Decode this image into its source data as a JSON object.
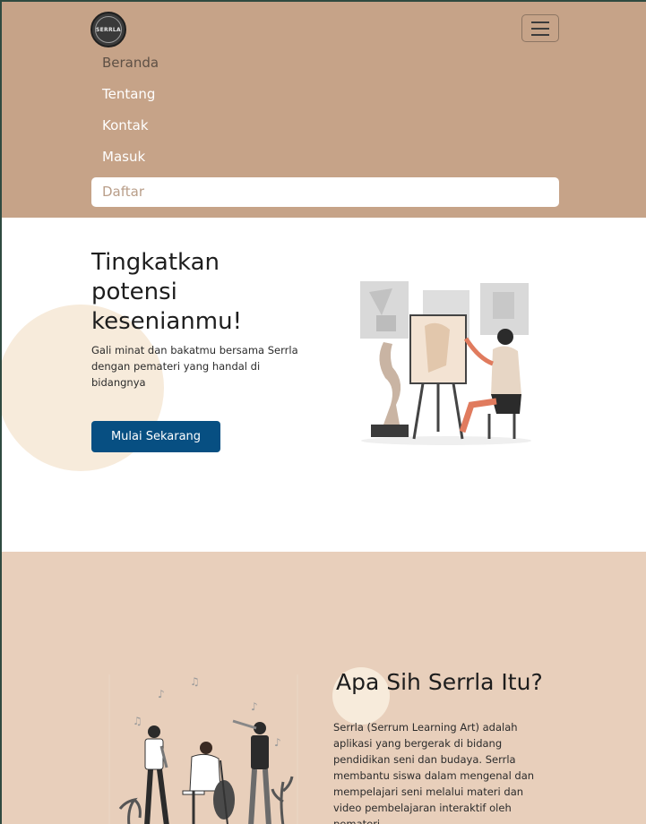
{
  "brand": {
    "logo_text": "SERRLA"
  },
  "nav": {
    "items": [
      {
        "label": "Beranda",
        "active": true
      },
      {
        "label": "Tentang",
        "active": false
      },
      {
        "label": "Kontak",
        "active": false
      },
      {
        "label": "Masuk",
        "active": false
      }
    ],
    "register_label": "Daftar"
  },
  "hero": {
    "title": "Tingkatkan potensi kesenianmu!",
    "subtitle": "Gali minat dan bakatmu bersama Serrla dengan pemateri yang handal di bidangnya",
    "cta_label": "Mulai Sekarang"
  },
  "about": {
    "title": "Apa Sih Serrla Itu?",
    "text": "Serrla (Serrum Learning Art) adalah aplikasi yang bergerak di bidang pendidikan seni dan budaya. Serrla membantu siswa dalam mengenal dan mempelajari seni melalui materi dan video pembelajaran interaktif oleh pemateri"
  },
  "colors": {
    "navbar_bg": "#c6a388",
    "cta_bg": "#074f82",
    "about_bg": "#e8cfbb",
    "accent_circle": "#f7ebdb"
  }
}
